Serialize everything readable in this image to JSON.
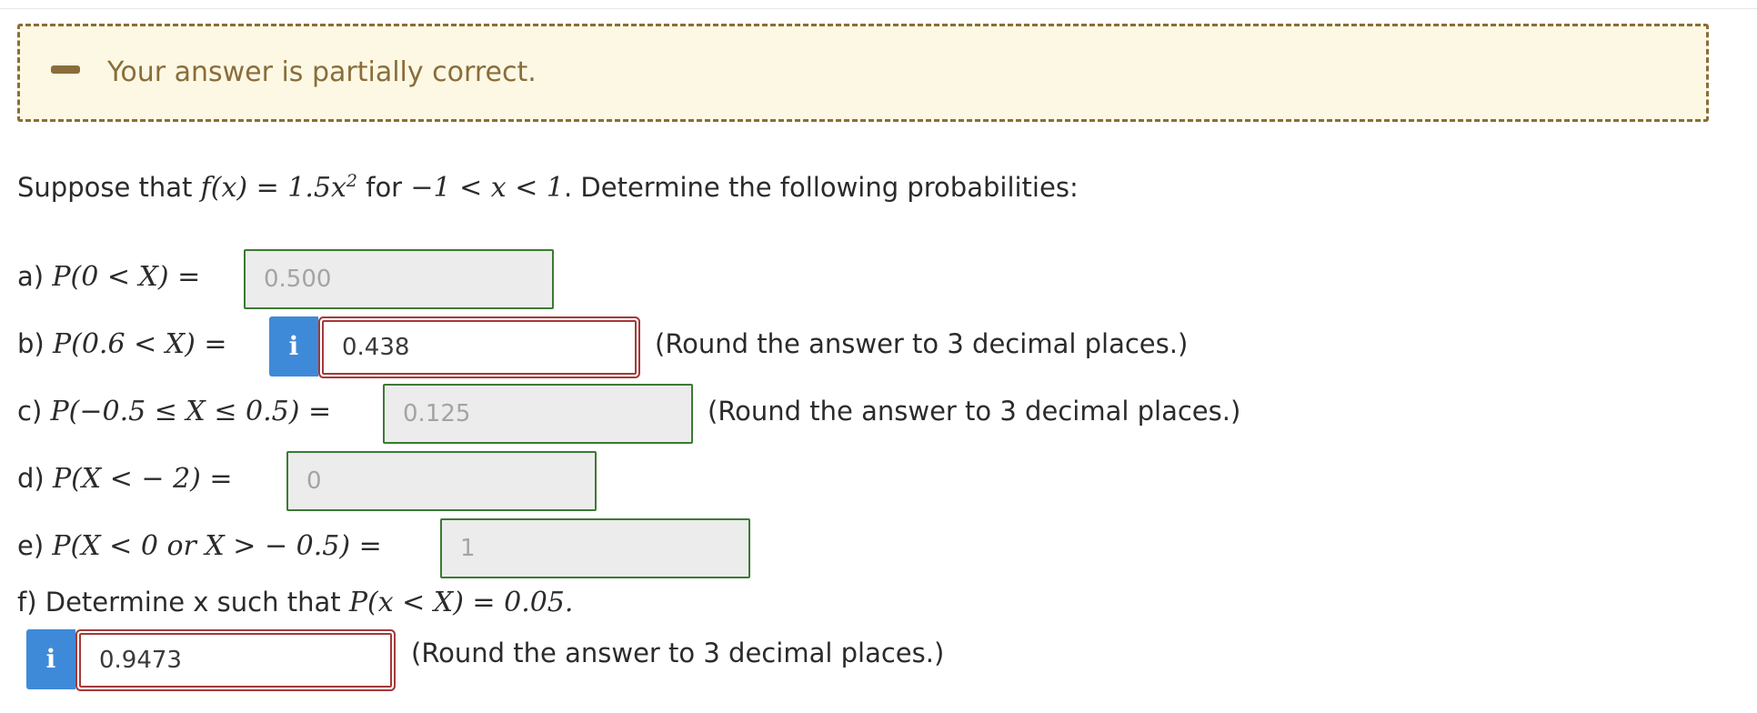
{
  "feedback": {
    "icon": "minus-icon",
    "message": "Your answer is partially correct."
  },
  "question": {
    "intro_prefix": "Suppose that ",
    "intro_math": "f(x) = 1.5x",
    "intro_exp": "2",
    "intro_for": " for ",
    "intro_range": "−1 < x < 1",
    "intro_suffix": ". Determine the following probabilities:"
  },
  "parts": [
    {
      "label": "a) ",
      "expr": "P(0 < X) =",
      "value": "0.500",
      "status": "correct"
    },
    {
      "label": "b) ",
      "expr": "P(0.6 < X) =",
      "value": "0.438",
      "status": "incorrect",
      "hint": "(Round the answer to 3 decimal places.)"
    },
    {
      "label": "c) ",
      "expr": "P(−0.5 ≤ X ≤ 0.5) =",
      "value": "0.125",
      "status": "correct",
      "hint": "(Round the answer to 3 decimal places.)"
    },
    {
      "label": "d) ",
      "expr": "P(X <  − 2) =",
      "value": "0",
      "status": "correct"
    },
    {
      "label": "e) ",
      "expr": "P(X < 0 or X >  − 0.5) =",
      "value": "1",
      "status": "correct"
    },
    {
      "label": "f) Determine x such that ",
      "expr": "P(x < X) = 0.05.",
      "value": "0.9473",
      "status": "incorrect",
      "hint": "(Round the answer to 3 decimal places.)"
    }
  ],
  "info_icon_glyph": "i",
  "colors": {
    "feedback_accent": "#8a6d3b",
    "feedback_bg": "#fcf8e3",
    "correct_border": "#3c7a34",
    "incorrect_border": "#a33a3a",
    "info_bg": "#3f8ad8"
  }
}
